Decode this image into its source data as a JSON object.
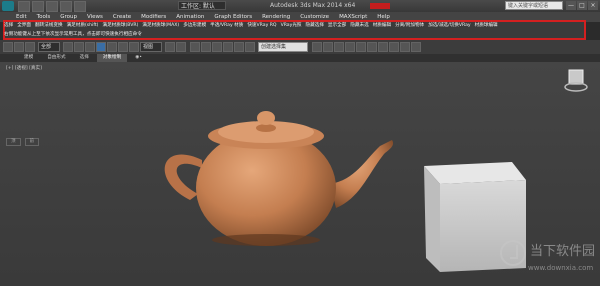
{
  "window": {
    "workspace": "工作区: 默认",
    "title": "Autodesk 3ds Max 2014 x64",
    "search_placeholder": "键入关键字或短语",
    "controls": [
      "—",
      "□",
      "×"
    ]
  },
  "menubar": [
    "Edit",
    "Tools",
    "Group",
    "Views",
    "Create",
    "Modifiers",
    "Animation",
    "Graph Editors",
    "Rendering",
    "Customize",
    "MAXScript",
    "Help"
  ],
  "annotation": {
    "row1": [
      "选择",
      "全界面",
      "翻转法线变换",
      "满足材质(shift)",
      "满足材质球(BVR)",
      "满足材质球(MAX)",
      "多边形建模",
      "半透/VRay 材质",
      "快速VRay RQ",
      "VRay光照",
      "隐藏选择",
      "显示全部",
      "隐藏未选",
      "材质编辑",
      "分离/附加物体",
      "加选/减选/切换VRay",
      "材质球编辑",
      "显示/隐藏对象",
      "物体转换为可编辑多边形",
      "清理场景",
      "渲染设置"
    ],
    "row2": "右侧功能键从上至下依次显示常用工具，点击即可快速执行相应命令"
  },
  "toolbar": {
    "selection_filter": "全部",
    "view_mode": "视图",
    "named_set": "创建选择集"
  },
  "ribbon_tabs": [
    "建模",
    "自由形式",
    "选择",
    "对象绘制",
    "◉•"
  ],
  "ribbon_active": 3,
  "viewport": {
    "label": "[+] [透视] [真实]",
    "sub_tabs": [
      "顶",
      "前"
    ]
  },
  "watermark": {
    "text": "当下软件园",
    "url": "www.downxia.com"
  },
  "colors": {
    "highlight_border": "#d42020",
    "teapot": "#c9875a",
    "box": "#d6d6d6",
    "viewport_bg": "#454545"
  }
}
